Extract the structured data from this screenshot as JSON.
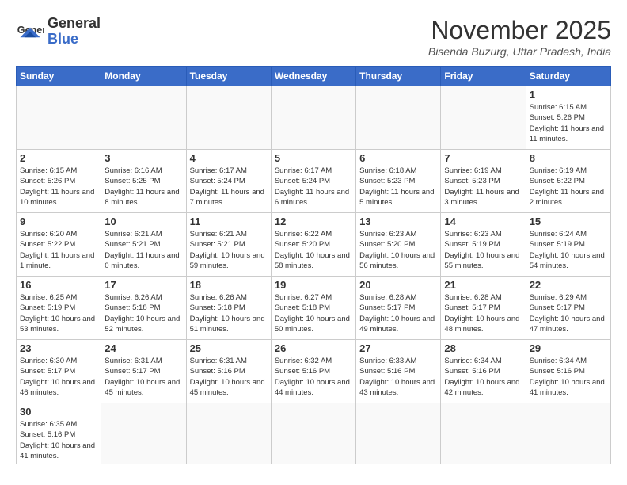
{
  "header": {
    "logo_general": "General",
    "logo_blue": "Blue",
    "month": "November 2025",
    "location": "Bisenda Buzurg, Uttar Pradesh, India"
  },
  "weekdays": [
    "Sunday",
    "Monday",
    "Tuesday",
    "Wednesday",
    "Thursday",
    "Friday",
    "Saturday"
  ],
  "weeks": [
    [
      {
        "day": "",
        "info": ""
      },
      {
        "day": "",
        "info": ""
      },
      {
        "day": "",
        "info": ""
      },
      {
        "day": "",
        "info": ""
      },
      {
        "day": "",
        "info": ""
      },
      {
        "day": "",
        "info": ""
      },
      {
        "day": "1",
        "info": "Sunrise: 6:15 AM\nSunset: 5:26 PM\nDaylight: 11 hours and 11 minutes."
      }
    ],
    [
      {
        "day": "2",
        "info": "Sunrise: 6:15 AM\nSunset: 5:26 PM\nDaylight: 11 hours and 10 minutes."
      },
      {
        "day": "3",
        "info": "Sunrise: 6:16 AM\nSunset: 5:25 PM\nDaylight: 11 hours and 8 minutes."
      },
      {
        "day": "4",
        "info": "Sunrise: 6:17 AM\nSunset: 5:24 PM\nDaylight: 11 hours and 7 minutes."
      },
      {
        "day": "5",
        "info": "Sunrise: 6:17 AM\nSunset: 5:24 PM\nDaylight: 11 hours and 6 minutes."
      },
      {
        "day": "6",
        "info": "Sunrise: 6:18 AM\nSunset: 5:23 PM\nDaylight: 11 hours and 5 minutes."
      },
      {
        "day": "7",
        "info": "Sunrise: 6:19 AM\nSunset: 5:23 PM\nDaylight: 11 hours and 3 minutes."
      },
      {
        "day": "8",
        "info": "Sunrise: 6:19 AM\nSunset: 5:22 PM\nDaylight: 11 hours and 2 minutes."
      }
    ],
    [
      {
        "day": "9",
        "info": "Sunrise: 6:20 AM\nSunset: 5:22 PM\nDaylight: 11 hours and 1 minute."
      },
      {
        "day": "10",
        "info": "Sunrise: 6:21 AM\nSunset: 5:21 PM\nDaylight: 11 hours and 0 minutes."
      },
      {
        "day": "11",
        "info": "Sunrise: 6:21 AM\nSunset: 5:21 PM\nDaylight: 10 hours and 59 minutes."
      },
      {
        "day": "12",
        "info": "Sunrise: 6:22 AM\nSunset: 5:20 PM\nDaylight: 10 hours and 58 minutes."
      },
      {
        "day": "13",
        "info": "Sunrise: 6:23 AM\nSunset: 5:20 PM\nDaylight: 10 hours and 56 minutes."
      },
      {
        "day": "14",
        "info": "Sunrise: 6:23 AM\nSunset: 5:19 PM\nDaylight: 10 hours and 55 minutes."
      },
      {
        "day": "15",
        "info": "Sunrise: 6:24 AM\nSunset: 5:19 PM\nDaylight: 10 hours and 54 minutes."
      }
    ],
    [
      {
        "day": "16",
        "info": "Sunrise: 6:25 AM\nSunset: 5:19 PM\nDaylight: 10 hours and 53 minutes."
      },
      {
        "day": "17",
        "info": "Sunrise: 6:26 AM\nSunset: 5:18 PM\nDaylight: 10 hours and 52 minutes."
      },
      {
        "day": "18",
        "info": "Sunrise: 6:26 AM\nSunset: 5:18 PM\nDaylight: 10 hours and 51 minutes."
      },
      {
        "day": "19",
        "info": "Sunrise: 6:27 AM\nSunset: 5:18 PM\nDaylight: 10 hours and 50 minutes."
      },
      {
        "day": "20",
        "info": "Sunrise: 6:28 AM\nSunset: 5:17 PM\nDaylight: 10 hours and 49 minutes."
      },
      {
        "day": "21",
        "info": "Sunrise: 6:28 AM\nSunset: 5:17 PM\nDaylight: 10 hours and 48 minutes."
      },
      {
        "day": "22",
        "info": "Sunrise: 6:29 AM\nSunset: 5:17 PM\nDaylight: 10 hours and 47 minutes."
      }
    ],
    [
      {
        "day": "23",
        "info": "Sunrise: 6:30 AM\nSunset: 5:17 PM\nDaylight: 10 hours and 46 minutes."
      },
      {
        "day": "24",
        "info": "Sunrise: 6:31 AM\nSunset: 5:17 PM\nDaylight: 10 hours and 45 minutes."
      },
      {
        "day": "25",
        "info": "Sunrise: 6:31 AM\nSunset: 5:16 PM\nDaylight: 10 hours and 45 minutes."
      },
      {
        "day": "26",
        "info": "Sunrise: 6:32 AM\nSunset: 5:16 PM\nDaylight: 10 hours and 44 minutes."
      },
      {
        "day": "27",
        "info": "Sunrise: 6:33 AM\nSunset: 5:16 PM\nDaylight: 10 hours and 43 minutes."
      },
      {
        "day": "28",
        "info": "Sunrise: 6:34 AM\nSunset: 5:16 PM\nDaylight: 10 hours and 42 minutes."
      },
      {
        "day": "29",
        "info": "Sunrise: 6:34 AM\nSunset: 5:16 PM\nDaylight: 10 hours and 41 minutes."
      }
    ],
    [
      {
        "day": "30",
        "info": "Sunrise: 6:35 AM\nSunset: 5:16 PM\nDaylight: 10 hours and 41 minutes."
      },
      {
        "day": "",
        "info": ""
      },
      {
        "day": "",
        "info": ""
      },
      {
        "day": "",
        "info": ""
      },
      {
        "day": "",
        "info": ""
      },
      {
        "day": "",
        "info": ""
      },
      {
        "day": "",
        "info": ""
      }
    ]
  ]
}
